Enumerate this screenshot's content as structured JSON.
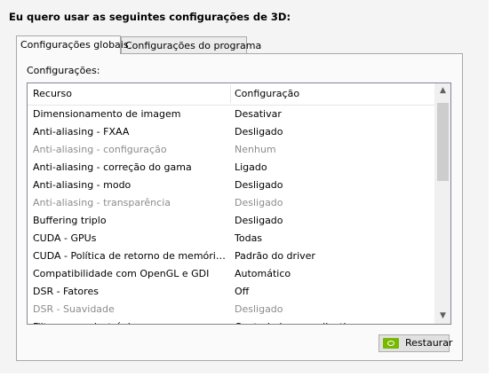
{
  "heading": "Eu quero usar as seguintes configurações de 3D:",
  "tabs": [
    {
      "label": "Configurações globais",
      "active": true
    },
    {
      "label": "Configurações do programa",
      "active": false
    }
  ],
  "settings_label": "Configurações:",
  "table": {
    "columns": [
      "Recurso",
      "Configuração"
    ],
    "rows": [
      {
        "feature": "Dimensionamento de imagem",
        "value": "Desativar",
        "disabled": false
      },
      {
        "feature": "Anti-aliasing - FXAA",
        "value": "Desligado",
        "disabled": false
      },
      {
        "feature": "Anti-aliasing - configuração",
        "value": "Nenhum",
        "disabled": true
      },
      {
        "feature": "Anti-aliasing - correção do gama",
        "value": "Ligado",
        "disabled": false
      },
      {
        "feature": "Anti-aliasing - modo",
        "value": "Desligado",
        "disabled": false
      },
      {
        "feature": "Anti-aliasing - transparência",
        "value": "Desligado",
        "disabled": true
      },
      {
        "feature": "Buffering triplo",
        "value": "Desligado",
        "disabled": false
      },
      {
        "feature": "CUDA - GPUs",
        "value": "Todas",
        "disabled": false
      },
      {
        "feature": "CUDA - Política de retorno de memória do ...",
        "value": "Padrão do driver",
        "disabled": false
      },
      {
        "feature": "Compatibilidade com OpenGL e GDI",
        "value": "Automático",
        "disabled": false
      },
      {
        "feature": "DSR - Fatores",
        "value": "Off",
        "disabled": false
      },
      {
        "feature": "DSR - Suavidade",
        "value": "Desligado",
        "disabled": true
      },
      {
        "feature": "Filtragem anisotrópica",
        "value": "Controlado por aplicativo",
        "disabled": false
      }
    ]
  },
  "restore_button": {
    "label": "Restaurar",
    "icon": "nvidia-icon"
  },
  "colors": {
    "nvidia_green": "#76b900",
    "disabled_text": "#8c8c8c"
  }
}
